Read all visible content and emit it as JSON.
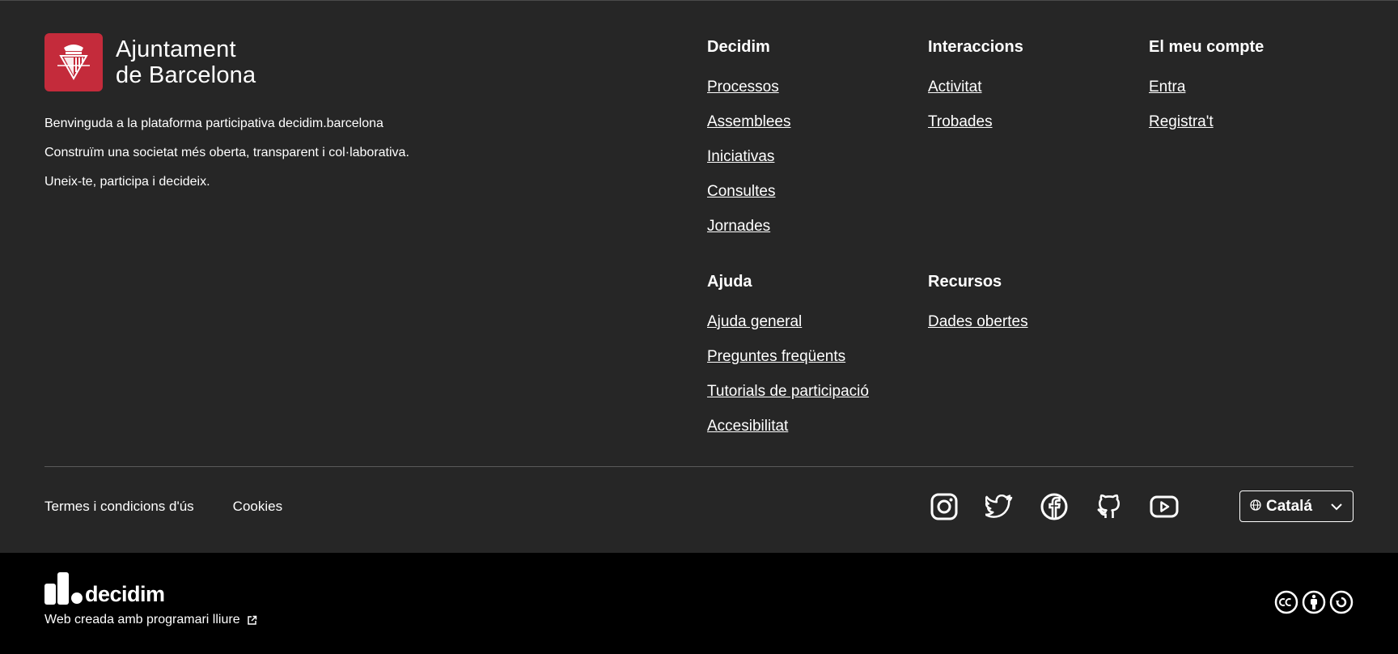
{
  "brand": {
    "line1": "Ajuntament",
    "line2": "de Barcelona",
    "badge_color": "#c42b3b"
  },
  "intro": [
    "Benvinguda a la plataforma participativa decidim.barcelona",
    "Construïm una societat més oberta, transparent i col·laborativa.",
    "Uneix-te, participa i decideix."
  ],
  "columns": {
    "decidim": {
      "title": "Decidim",
      "links": [
        "Processos",
        "Assemblees",
        "Iniciativas",
        "Consultes",
        "Jornades"
      ]
    },
    "interaccions": {
      "title": "Interaccions",
      "links": [
        "Activitat",
        "Trobades"
      ]
    },
    "compte": {
      "title": "El meu compte",
      "links": [
        "Entra",
        "Registra't"
      ]
    },
    "ajuda": {
      "title": "Ajuda",
      "links": [
        "Ajuda general",
        "Preguntes freqüents",
        "Tutorials de participació",
        "Accesibilitat"
      ]
    },
    "recursos": {
      "title": "Recursos",
      "links": [
        "Dades obertes"
      ]
    }
  },
  "legal": {
    "terms": "Termes i condicions d'ús",
    "cookies": "Cookies"
  },
  "social": [
    "instagram-icon",
    "twitter-icon",
    "facebook-icon",
    "github-icon",
    "youtube-icon"
  ],
  "language": {
    "selected": "Catalá"
  },
  "bottom": {
    "logo_word": "decidim",
    "credit": "Web creada amb programari lliure"
  },
  "colors": {
    "background": "#262626",
    "bottom_bar": "#000000",
    "text": "#ffffff"
  }
}
